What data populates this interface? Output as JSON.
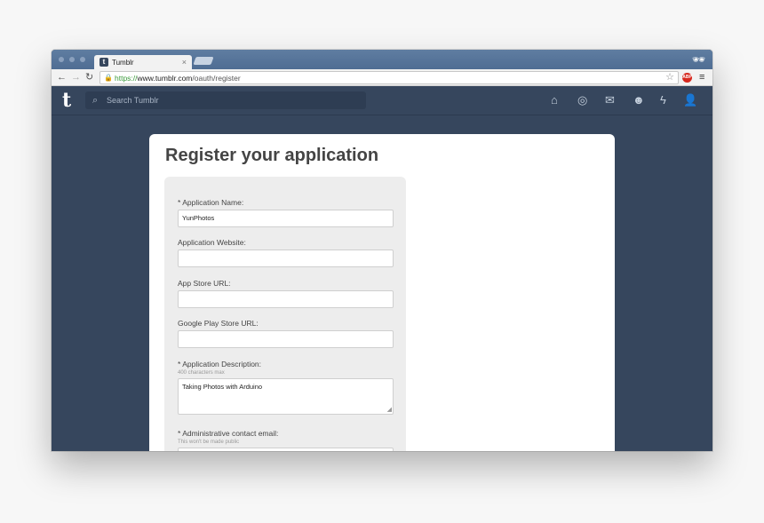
{
  "browser": {
    "tab_title": "Tumblr",
    "tab_close": "×",
    "url_scheme": "https://",
    "url_host": "www.tumblr.com",
    "url_path": "/oauth/register",
    "abp_badge": "ABP"
  },
  "header": {
    "logo": "t",
    "search_placeholder": "Search Tumblr"
  },
  "page": {
    "title": "Register your application"
  },
  "form": {
    "app_name_label": "* Application Name:",
    "app_name_value": "YunPhotos",
    "website_label": "Application Website:",
    "website_value": "",
    "appstore_label": "App Store URL:",
    "appstore_value": "",
    "playstore_label": "Google Play Store URL:",
    "playstore_value": "",
    "description_label": "* Application Description:",
    "description_hint": "400 characters max",
    "description_value": "Taking Photos with Arduino",
    "email_label": "* Administrative contact email:",
    "email_hint": "This won't be made public",
    "email_value": ""
  }
}
